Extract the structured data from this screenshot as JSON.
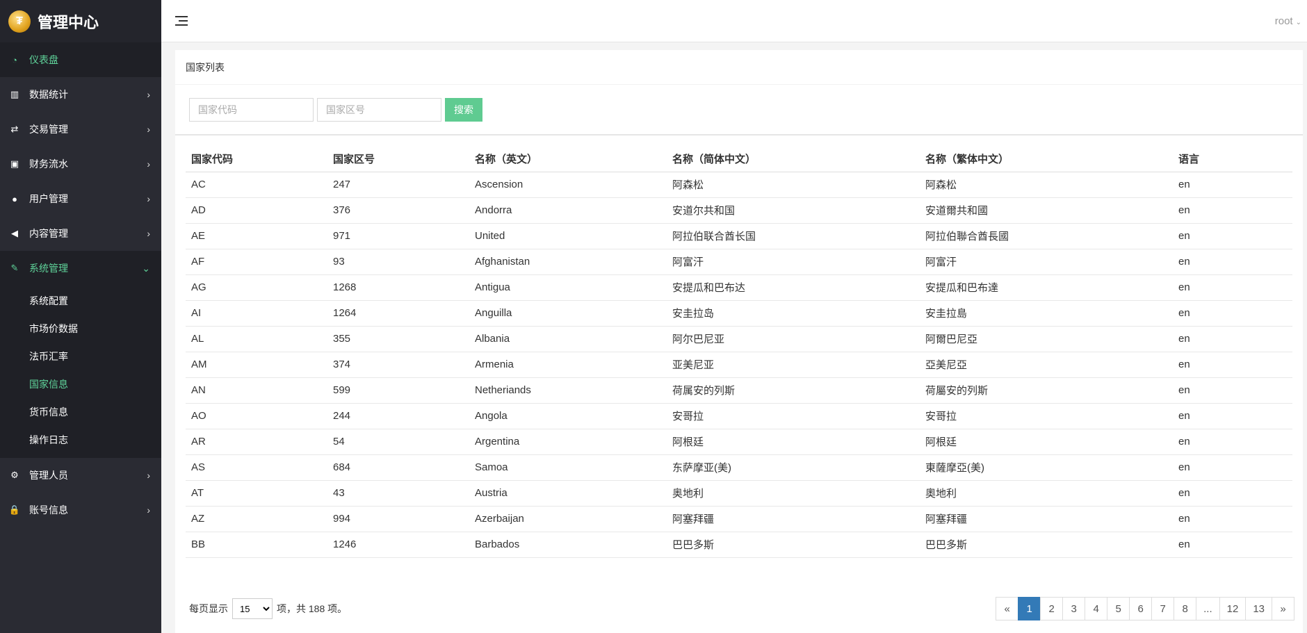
{
  "brand": {
    "title": "管理中心",
    "logo_glyph": "₮"
  },
  "sidebar": {
    "items": [
      {
        "icon": "dashboard-icon",
        "glyph": "◔",
        "label": "仪表盘",
        "arrow": ""
      },
      {
        "icon": "bar-chart-icon",
        "glyph": "▥",
        "label": "数据统计",
        "arrow": "›"
      },
      {
        "icon": "exchange-icon",
        "glyph": "⇄",
        "label": "交易管理",
        "arrow": "›"
      },
      {
        "icon": "money-icon",
        "glyph": "▣",
        "label": "财务流水",
        "arrow": "›"
      },
      {
        "icon": "users-icon",
        "glyph": "●",
        "label": "用户管理",
        "arrow": "›"
      },
      {
        "icon": "bullhorn-icon",
        "glyph": "◀",
        "label": "内容管理",
        "arrow": "›"
      },
      {
        "icon": "wrench-icon",
        "glyph": "✎",
        "label": "系统管理",
        "arrow": "⌄"
      }
    ],
    "submenu": [
      {
        "label": "系统配置"
      },
      {
        "label": "市场价数据"
      },
      {
        "label": "法币汇率"
      },
      {
        "label": "国家信息"
      },
      {
        "label": "货币信息"
      },
      {
        "label": "操作日志"
      }
    ],
    "bottom_items": [
      {
        "icon": "cogs-icon",
        "glyph": "⚙",
        "label": "管理人员",
        "arrow": "›"
      },
      {
        "icon": "lock-icon",
        "glyph": "🔒",
        "label": "账号信息",
        "arrow": "›"
      }
    ]
  },
  "header": {
    "user": "root",
    "caret": "⌄"
  },
  "panel": {
    "title": "国家列表",
    "search": {
      "code_placeholder": "国家代码",
      "area_placeholder": "国家区号",
      "button": "搜索"
    }
  },
  "table": {
    "headers": [
      "国家代码",
      "国家区号",
      "名称（英文）",
      "名称（简体中文）",
      "名称（繁体中文）",
      "语言"
    ],
    "rows": [
      [
        "AC",
        "247",
        "Ascension",
        "阿森松",
        "阿森松",
        "en"
      ],
      [
        "AD",
        "376",
        "Andorra",
        "安道尔共和国",
        "安道爾共和國",
        "en"
      ],
      [
        "AE",
        "971",
        "United",
        "阿拉伯联合酋长国",
        "阿拉伯聯合酋長國",
        "en"
      ],
      [
        "AF",
        "93",
        "Afghanistan",
        "阿富汗",
        "阿富汗",
        "en"
      ],
      [
        "AG",
        "1268",
        "Antigua",
        "安提瓜和巴布达",
        "安提瓜和巴布達",
        "en"
      ],
      [
        "AI",
        "1264",
        "Anguilla",
        "安圭拉岛",
        "安圭拉島",
        "en"
      ],
      [
        "AL",
        "355",
        "Albania",
        "阿尔巴尼亚",
        "阿爾巴尼亞",
        "en"
      ],
      [
        "AM",
        "374",
        "Armenia",
        "亚美尼亚",
        "亞美尼亞",
        "en"
      ],
      [
        "AN",
        "599",
        "Netheriands",
        "荷属安的列斯",
        "荷屬安的列斯",
        "en"
      ],
      [
        "AO",
        "244",
        "Angola",
        "安哥拉",
        "安哥拉",
        "en"
      ],
      [
        "AR",
        "54",
        "Argentina",
        "阿根廷",
        "阿根廷",
        "en"
      ],
      [
        "AS",
        "684",
        "Samoa",
        "东萨摩亚(美)",
        "東薩摩亞(美)",
        "en"
      ],
      [
        "AT",
        "43",
        "Austria",
        "奥地利",
        "奧地利",
        "en"
      ],
      [
        "AZ",
        "994",
        "Azerbaijan",
        "阿塞拜疆",
        "阿塞拜疆",
        "en"
      ],
      [
        "BB",
        "1246",
        "Barbados",
        "巴巴多斯",
        "巴巴多斯",
        "en"
      ]
    ]
  },
  "footer": {
    "per_page_label": "每页显示",
    "per_page_value": "15",
    "total_text": "项，共 188 项。",
    "pages": [
      "«",
      "1",
      "2",
      "3",
      "4",
      "5",
      "6",
      "7",
      "8",
      "...",
      "12",
      "13",
      "»"
    ],
    "active_page": "1"
  },
  "colors": {
    "accent": "#5fcb91",
    "sidebar_bg": "#2a2b33",
    "active_green": "#5fd39a",
    "page_active": "#337ab7"
  }
}
